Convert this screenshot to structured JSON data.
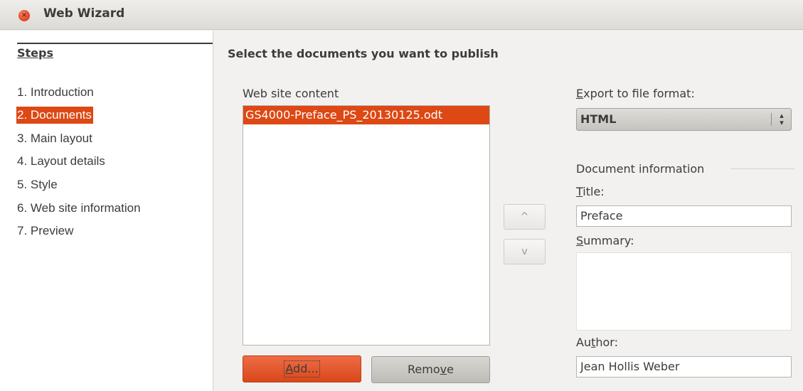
{
  "window": {
    "title": "Web Wizard"
  },
  "steps": {
    "heading": "Steps",
    "items": [
      {
        "label": "1. Introduction",
        "active": false
      },
      {
        "label": "2. Documents",
        "active": true
      },
      {
        "label": "3. Main layout",
        "active": false
      },
      {
        "label": "4. Layout details",
        "active": false
      },
      {
        "label": "5. Style",
        "active": false
      },
      {
        "label": "6. Web site information",
        "active": false
      },
      {
        "label": "7. Preview",
        "active": false
      }
    ]
  },
  "main": {
    "section_title": "Select the documents you want to publish",
    "content_label": "Web site content",
    "content_items": [
      "GS4000-Preface_PS_20130125.odt"
    ],
    "add_button": {
      "before": "",
      "mnemonic": "A",
      "after": "dd..."
    },
    "remove_button": {
      "before": "Remo",
      "mnemonic": "v",
      "after": "e"
    },
    "move_up_symbol": "^",
    "move_down_symbol": "v"
  },
  "export": {
    "label": {
      "before": "",
      "mnemonic": "E",
      "after": "xport to file format:"
    },
    "value": "HTML"
  },
  "doc_info": {
    "heading": "Document information",
    "title_label": {
      "before": "",
      "mnemonic": "T",
      "after": "itle:"
    },
    "title_value": "Preface",
    "summary_label": {
      "before": "",
      "mnemonic": "S",
      "after": "ummary:"
    },
    "summary_value": "",
    "author_label": {
      "before": "Au",
      "mnemonic": "t",
      "after": "hor:"
    },
    "author_value": "Jean Hollis Weber"
  },
  "colors": {
    "accent": "#dd4814",
    "window_bg": "#f2f1f0",
    "text": "#3c3c3c"
  },
  "icons": {
    "close": "close-icon",
    "select_arrows": "up-down-arrows-icon"
  }
}
